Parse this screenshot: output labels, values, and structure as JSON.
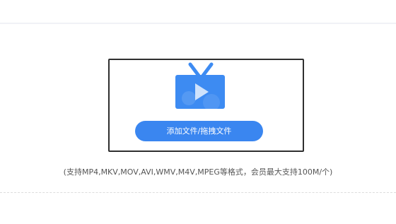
{
  "upload": {
    "button_label": "添加文件/拖拽文件",
    "hint": "(支持MP4,MKV,MOV,AVI,WMV,M4V,MPEG等格式，会员最大支持100M/个)",
    "icon": "video-tv-icon"
  },
  "colors": {
    "accent": "#3a86f0",
    "icon_blue": "#3d8bf2",
    "box_border": "#2f2f2f",
    "hint_text": "#555555"
  }
}
